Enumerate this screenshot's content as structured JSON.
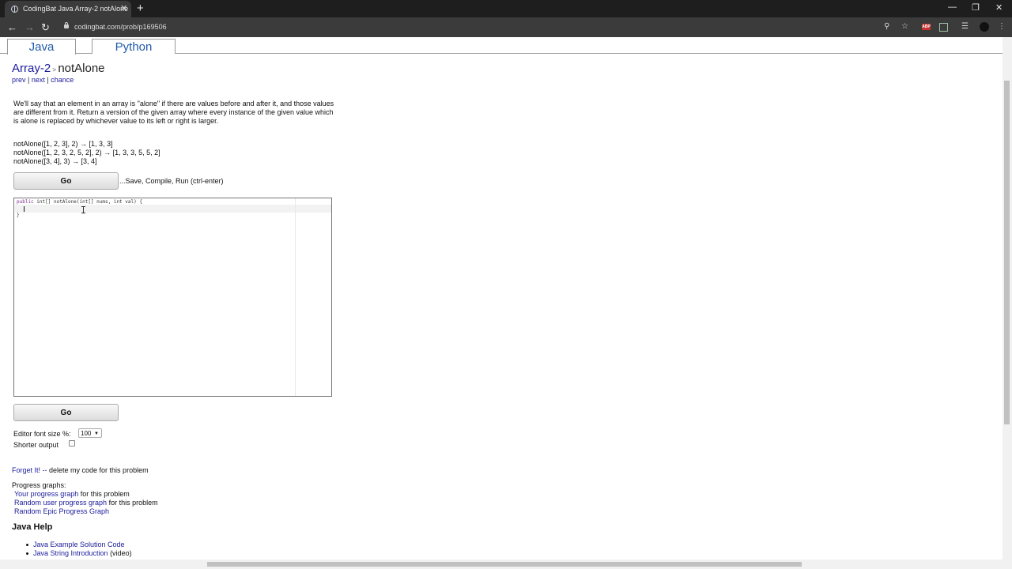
{
  "browser": {
    "tab_title": "CodingBat Java Array-2 notAlone",
    "tab_close": "✕",
    "new_tab": "+",
    "url": "codingbat.com/prob/p169506",
    "window_controls": {
      "minimize": "—",
      "restore": "❐",
      "close": "✕"
    },
    "icons": [
      "back-arrow-icon",
      "forward-arrow-icon",
      "reload-icon",
      "lock-icon",
      "key-icon",
      "star-icon",
      "adblock-icon",
      "extension-icon",
      "reading-list-icon",
      "avatar-icon",
      "menu-icon"
    ],
    "abp_label": "ABP"
  },
  "lang_tabs": {
    "java": "Java",
    "python": "Python"
  },
  "breadcrumb": {
    "category": "Array-2",
    "sep": " > ",
    "problem": "notAlone"
  },
  "prevnext": {
    "prev": "prev",
    "sep1": " | ",
    "next": "next",
    "sep2": " | ",
    "chance": "chance"
  },
  "description": "We'll say that an element in an array is \"alone\" if there are values before and after it, and those values are different from it. Return a version of the given array where every instance of the given value which is alone is replaced by whichever value to its left or right is larger.",
  "examples": [
    "notAlone([1, 2, 3], 2) → [1, 3, 3]",
    "notAlone([1, 2, 3, 2, 5, 2], 2) → [1, 3, 3, 5, 5, 2]",
    "notAlone([3, 4], 3) → [3, 4]"
  ],
  "go_label": "Go",
  "save_hint": "...Save, Compile, Run (ctrl-enter)",
  "editor": {
    "line1_kw": "public",
    "line1_rest": " int[] notAlone(int[] nums, int val) {",
    "line2": "  ",
    "line3": "}"
  },
  "options": {
    "font_size_label": "Editor font size %:",
    "font_size_value": "100",
    "shorter_label": "Shorter output",
    "shorter_checked": false
  },
  "forget": {
    "link": "Forget It! --",
    "rest": " delete my code for this problem"
  },
  "progress": {
    "title": "Progress graphs:",
    "items": [
      {
        "link": "Your progress graph",
        "rest": " for this problem"
      },
      {
        "link": "Random user progress graph",
        "rest": " for this problem"
      },
      {
        "link": "Random Epic Progress Graph",
        "rest": ""
      }
    ]
  },
  "java_help": {
    "title": "Java Help",
    "items": [
      {
        "link": "Java Example Solution Code",
        "rest": ""
      },
      {
        "link": "Java String Introduction",
        "rest": " (video)"
      }
    ]
  },
  "colors": {
    "link": "#1a1a9c",
    "tab_text": "#1e5aa8",
    "keyword": "#7a2a8a",
    "chrome_dark": "#1e1e1e",
    "chrome_toolbar": "#3b3b3b"
  }
}
